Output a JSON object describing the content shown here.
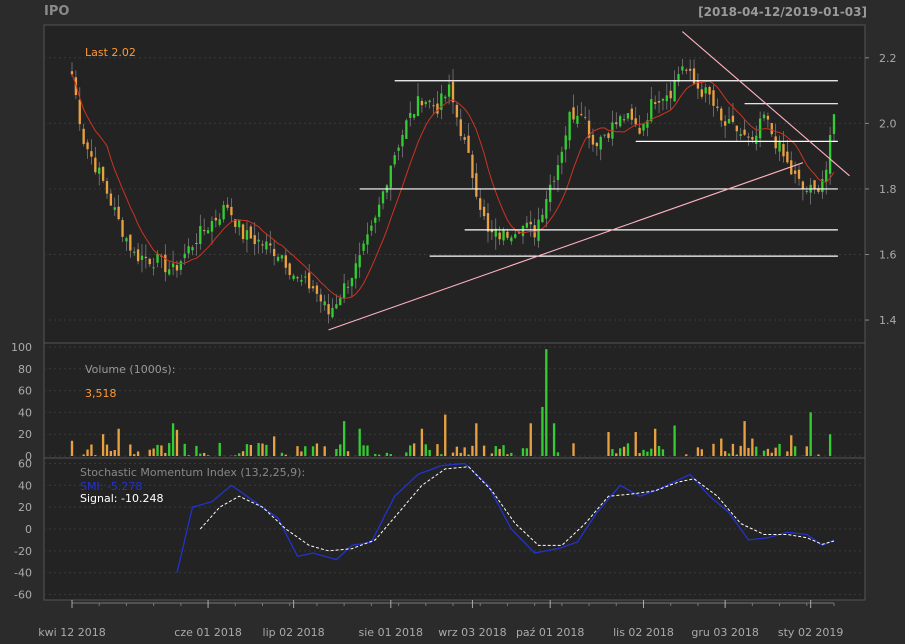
{
  "header": {
    "symbol": "IPO",
    "date_range": "[2018-04-12/2019-01-03]"
  },
  "colors": {
    "background": "#2b2b2b",
    "up": "#33cc33",
    "down": "#e8a040",
    "sma": "#cc3322",
    "trendline": "#ffb0c0",
    "level": "#ffffff",
    "smi": "#2233cc",
    "signal": "#ffffff",
    "text": "#9a9a9a",
    "last": "#ff9933"
  },
  "chart_data": [
    {
      "type": "candlestick",
      "panel": "price",
      "last_label": "Last 2.02",
      "y_ticks": [
        "1.4",
        "1.6",
        "1.8",
        "2.0",
        "2.2"
      ],
      "ylim": [
        1.33,
        2.3
      ],
      "x_tick_labels": [
        "kwi 12 2018",
        "cze 01 2018",
        "lip 02 2018",
        "sie 01 2018",
        "wrz 03 2018",
        "paź 01 2018",
        "lis 02 2018",
        "gru 03 2018",
        "sty 02 2019"
      ],
      "anchor_closes": [
        [
          0,
          2.15
        ],
        [
          3,
          1.95
        ],
        [
          8,
          1.82
        ],
        [
          12,
          1.7
        ],
        [
          16,
          1.6
        ],
        [
          22,
          1.58
        ],
        [
          26,
          1.55
        ],
        [
          32,
          1.65
        ],
        [
          36,
          1.7
        ],
        [
          40,
          1.75
        ],
        [
          44,
          1.66
        ],
        [
          48,
          1.64
        ],
        [
          54,
          1.6
        ],
        [
          58,
          1.52
        ],
        [
          62,
          1.5
        ],
        [
          66,
          1.42
        ],
        [
          70,
          1.5
        ],
        [
          74,
          1.58
        ],
        [
          78,
          1.7
        ],
        [
          82,
          1.88
        ],
        [
          86,
          2.0
        ],
        [
          90,
          2.08
        ],
        [
          94,
          2.05
        ],
        [
          97,
          2.1
        ],
        [
          100,
          1.98
        ],
        [
          104,
          1.8
        ],
        [
          107,
          1.66
        ],
        [
          111,
          1.66
        ],
        [
          115,
          1.69
        ],
        [
          119,
          1.67
        ],
        [
          122,
          1.78
        ],
        [
          125,
          1.88
        ],
        [
          128,
          2.02
        ],
        [
          131,
          2.05
        ],
        [
          134,
          1.94
        ],
        [
          138,
          1.98
        ],
        [
          142,
          2.02
        ],
        [
          146,
          1.98
        ],
        [
          150,
          2.08
        ],
        [
          154,
          2.1
        ],
        [
          157,
          2.18
        ],
        [
          160,
          2.12
        ],
        [
          164,
          2.08
        ],
        [
          167,
          2.0
        ],
        [
          171,
          1.98
        ],
        [
          175,
          1.93
        ],
        [
          178,
          2.02
        ],
        [
          182,
          1.92
        ],
        [
          185,
          1.85
        ],
        [
          188,
          1.8
        ],
        [
          191,
          1.79
        ],
        [
          194,
          1.86
        ],
        [
          196,
          2.02
        ]
      ],
      "n_bars": 197,
      "horizontal_levels": [
        {
          "value": 2.13,
          "from_bar": 83,
          "to_bar": 197
        },
        {
          "value": 2.06,
          "from_bar": 173,
          "to_bar": 197
        },
        {
          "value": 1.945,
          "from_bar": 145,
          "to_bar": 197
        },
        {
          "value": 1.8,
          "from_bar": 74,
          "to_bar": 197
        },
        {
          "value": 1.675,
          "from_bar": 101,
          "to_bar": 197
        },
        {
          "value": 1.595,
          "from_bar": 92,
          "to_bar": 197
        }
      ],
      "trendlines": [
        {
          "from": [
            66,
            1.37
          ],
          "to": [
            188,
            1.88
          ]
        },
        {
          "from": [
            157,
            2.28
          ],
          "to": [
            200,
            1.84
          ]
        }
      ]
    },
    {
      "type": "bar",
      "panel": "volume",
      "label": "Volume (1000s):",
      "last_value": "3,518",
      "y_ticks": [
        "0",
        "20",
        "40",
        "60",
        "80",
        "100"
      ],
      "ylim": [
        0,
        100
      ],
      "peak": {
        "bar": 122,
        "value": 98
      },
      "notable": [
        [
          0,
          14
        ],
        [
          8,
          20
        ],
        [
          12,
          25
        ],
        [
          26,
          30
        ],
        [
          27,
          24
        ],
        [
          38,
          12
        ],
        [
          52,
          18
        ],
        [
          70,
          32
        ],
        [
          74,
          25
        ],
        [
          90,
          25
        ],
        [
          96,
          38
        ],
        [
          104,
          30
        ],
        [
          118,
          30
        ],
        [
          121,
          45
        ],
        [
          124,
          30
        ],
        [
          138,
          22
        ],
        [
          145,
          22
        ],
        [
          150,
          25
        ],
        [
          155,
          28
        ],
        [
          167,
          16
        ],
        [
          173,
          32
        ],
        [
          175,
          16
        ],
        [
          185,
          19
        ],
        [
          190,
          40
        ],
        [
          195,
          20
        ]
      ]
    },
    {
      "type": "line",
      "panel": "smi",
      "label": "Stochastic Momentum Index (13,2,25,9):",
      "smi_label": "SMI: -5.278",
      "signal_label": "Signal: -10.248",
      "y_ticks": [
        "60",
        "40",
        "20",
        "0",
        "-20",
        "-40",
        "-60"
      ],
      "ylim": [
        -65,
        65
      ],
      "smi_start_bar": 27,
      "smi_anchors": [
        [
          27,
          -40
        ],
        [
          31,
          20
        ],
        [
          36,
          25
        ],
        [
          41,
          40
        ],
        [
          47,
          25
        ],
        [
          53,
          10
        ],
        [
          58,
          -25
        ],
        [
          62,
          -22
        ],
        [
          68,
          -28
        ],
        [
          72,
          -15
        ],
        [
          77,
          -12
        ],
        [
          83,
          30
        ],
        [
          89,
          50
        ],
        [
          95,
          58
        ],
        [
          101,
          60
        ],
        [
          107,
          40
        ],
        [
          113,
          0
        ],
        [
          119,
          -22
        ],
        [
          125,
          -18
        ],
        [
          130,
          -12
        ],
        [
          135,
          15
        ],
        [
          141,
          40
        ],
        [
          146,
          30
        ],
        [
          150,
          35
        ],
        [
          156,
          45
        ],
        [
          159,
          50
        ],
        [
          164,
          30
        ],
        [
          169,
          15
        ],
        [
          174,
          -10
        ],
        [
          179,
          -8
        ],
        [
          184,
          -3
        ],
        [
          189,
          -5
        ],
        [
          193,
          -15
        ],
        [
          196,
          -10
        ]
      ],
      "signal_anchors": [
        [
          33,
          0
        ],
        [
          38,
          20
        ],
        [
          43,
          30
        ],
        [
          49,
          20
        ],
        [
          55,
          0
        ],
        [
          61,
          -15
        ],
        [
          66,
          -20
        ],
        [
          72,
          -18
        ],
        [
          78,
          -10
        ],
        [
          84,
          15
        ],
        [
          90,
          40
        ],
        [
          96,
          55
        ],
        [
          102,
          57
        ],
        [
          108,
          35
        ],
        [
          114,
          5
        ],
        [
          120,
          -15
        ],
        [
          126,
          -15
        ],
        [
          132,
          5
        ],
        [
          138,
          30
        ],
        [
          144,
          32
        ],
        [
          150,
          35
        ],
        [
          156,
          43
        ],
        [
          160,
          46
        ],
        [
          166,
          30
        ],
        [
          172,
          5
        ],
        [
          178,
          -5
        ],
        [
          184,
          -5
        ],
        [
          189,
          -8
        ],
        [
          193,
          -14
        ],
        [
          196,
          -11
        ]
      ]
    }
  ]
}
